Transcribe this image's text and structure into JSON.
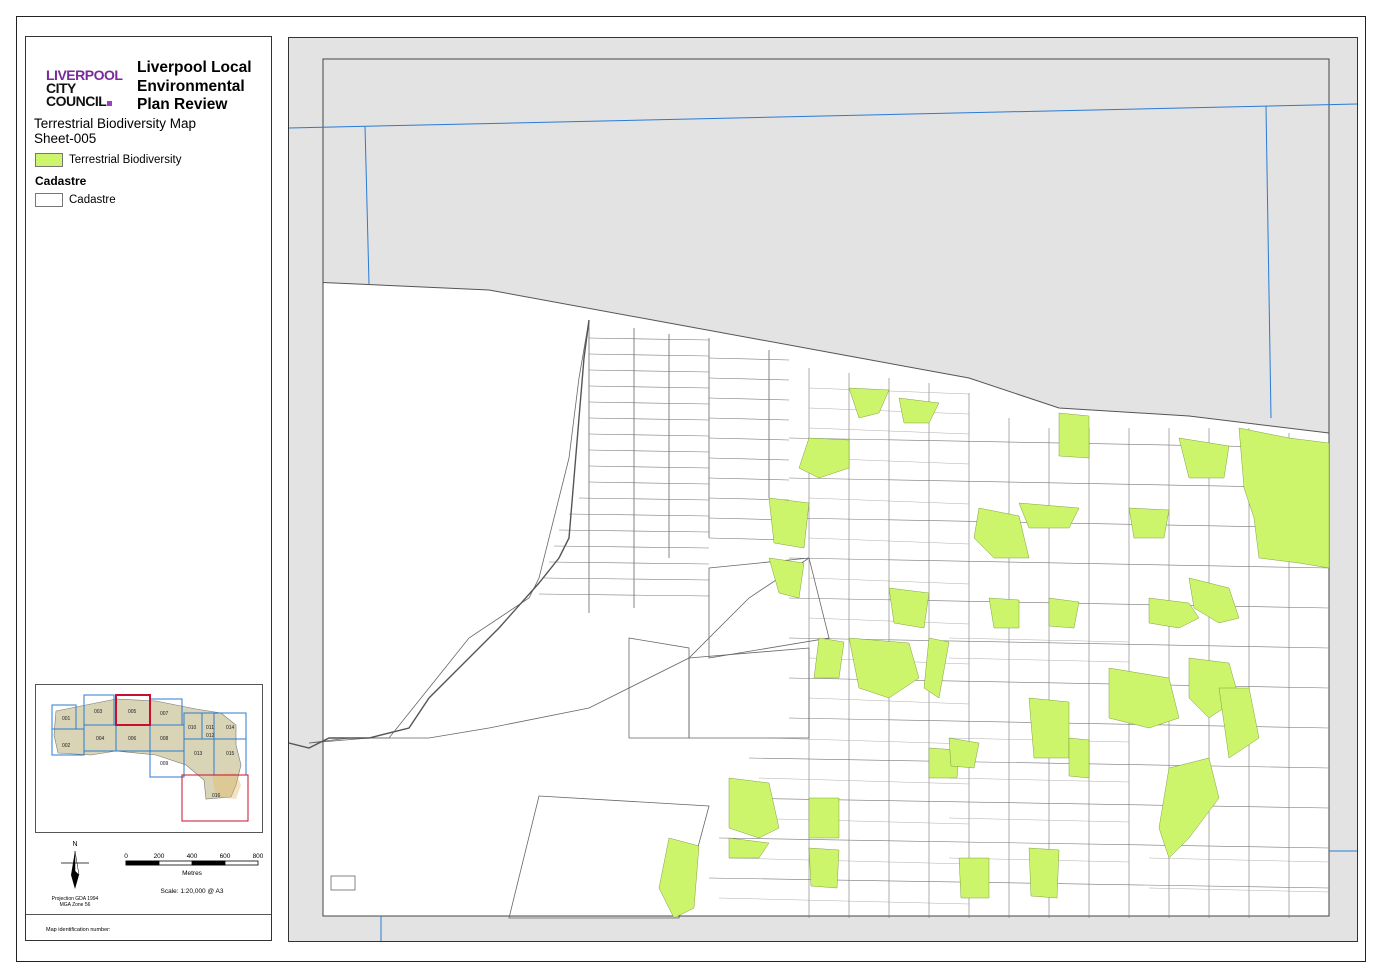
{
  "logo": {
    "line1": "LIVERPOOL",
    "line2": "CITY",
    "line3": "COUNCIL",
    "brand_color": "#7a2a9a"
  },
  "title": {
    "line1": "Liverpool Local",
    "line2": "Environmental",
    "line3": "Plan Review"
  },
  "subtitle": {
    "line1": "Terrestrial Biodiversity Map",
    "line2": "Sheet-005"
  },
  "legend": {
    "items": [
      {
        "label": "Terrestrial Biodiversity",
        "color": "#ccf56b"
      }
    ],
    "cadastre_heading": "Cadastre",
    "cadastre_item": {
      "label": "Cadastre",
      "color": "#ffffff"
    }
  },
  "keymap": {
    "sheets": [
      "001",
      "002",
      "003",
      "004",
      "005",
      "006",
      "007",
      "008",
      "009",
      "010",
      "011",
      "012",
      "013",
      "014",
      "015",
      "016"
    ],
    "highlighted": "005",
    "highlight_color": "#c8102e",
    "grid_color": "#2b7bd4",
    "land_color": "#d9d4b5"
  },
  "north_arrow": {
    "label": "N"
  },
  "scale": {
    "ticks": [
      "0",
      "200",
      "400",
      "600",
      "800"
    ],
    "unit": "Metres",
    "text": "Scale: 1:20,000 @ A3"
  },
  "projection": {
    "line1": "Projection GDA 1994",
    "line2": "MGA Zone 56"
  },
  "map_id_label": "Map identification number:",
  "map": {
    "background_color": "#e3e3e3",
    "parcel_color": "#ffffff",
    "parcel_line_color": "#555555",
    "grid_line_color": "#2b7bd4",
    "biodiversity_color": "#ccf56b"
  }
}
